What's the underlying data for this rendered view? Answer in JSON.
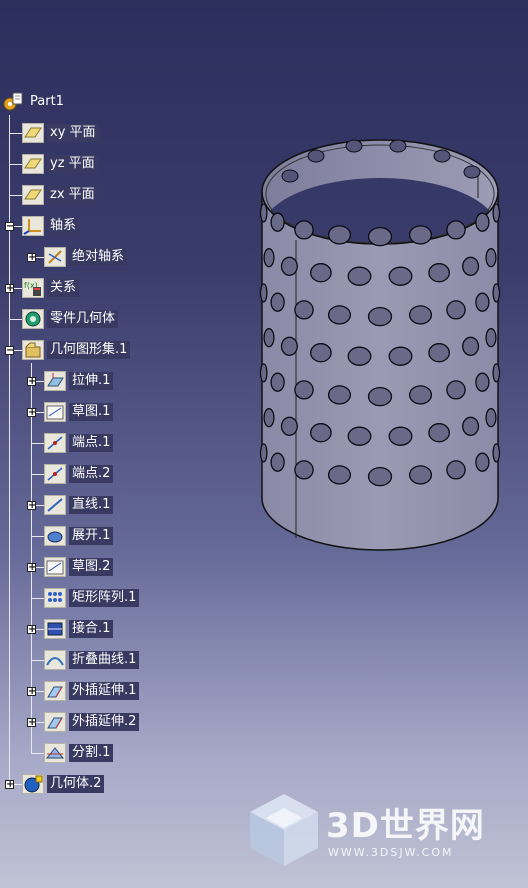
{
  "tree": {
    "root": {
      "label": "Part1",
      "icon": "part-gear-icon"
    },
    "items": [
      {
        "label": "xy 平面",
        "icon": "plane-icon",
        "expander": null
      },
      {
        "label": "yz 平面",
        "icon": "plane-icon",
        "expander": null
      },
      {
        "label": "zx 平面",
        "icon": "plane-icon",
        "expander": null
      },
      {
        "label": "轴系",
        "icon": "axis-system-icon",
        "expander": "collapse"
      },
      {
        "label": "绝对轴系",
        "icon": "absolute-axis-icon",
        "expander": "expand"
      },
      {
        "label": "关系",
        "icon": "relations-icon",
        "expander": "expand"
      },
      {
        "label": "零件几何体",
        "icon": "part-body-icon",
        "expander": null
      },
      {
        "label": "几何图形集.1",
        "icon": "geometrical-set-icon",
        "expander": "collapse"
      },
      {
        "label": "拉伸.1",
        "icon": "extrude-icon",
        "expander": "expand"
      },
      {
        "label": "草图.1",
        "icon": "sketch-icon",
        "expander": "expand"
      },
      {
        "label": "端点.1",
        "icon": "point-icon",
        "expander": null
      },
      {
        "label": "端点.2",
        "icon": "point-icon",
        "expander": null
      },
      {
        "label": "直线.1",
        "icon": "line-icon",
        "expander": "expand"
      },
      {
        "label": "展开.1",
        "icon": "unfold-icon",
        "expander": null
      },
      {
        "label": "草图.2",
        "icon": "sketch-icon",
        "expander": "expand"
      },
      {
        "label": "矩形阵列.1",
        "icon": "rect-pattern-icon",
        "expander": null
      },
      {
        "label": "接合.1",
        "icon": "join-icon",
        "expander": "expand"
      },
      {
        "label": "折叠曲线.1",
        "icon": "fold-curve-icon",
        "expander": null
      },
      {
        "label": "外插延伸.1",
        "icon": "extrapolate-icon",
        "expander": "expand"
      },
      {
        "label": "外插延伸.2",
        "icon": "extrapolate-icon",
        "expander": "expand"
      },
      {
        "label": "分割.1",
        "icon": "split-icon",
        "expander": null
      },
      {
        "label": "几何体.2",
        "icon": "body-icon",
        "expander": "expand"
      }
    ]
  },
  "watermark": {
    "title": "3D世界网",
    "url": "WWW.3DSJW.COM"
  },
  "colors": {
    "label_bg": "#383a62",
    "cylinder_face": "#8c8ca6",
    "background_top": "#2c2e5c"
  }
}
